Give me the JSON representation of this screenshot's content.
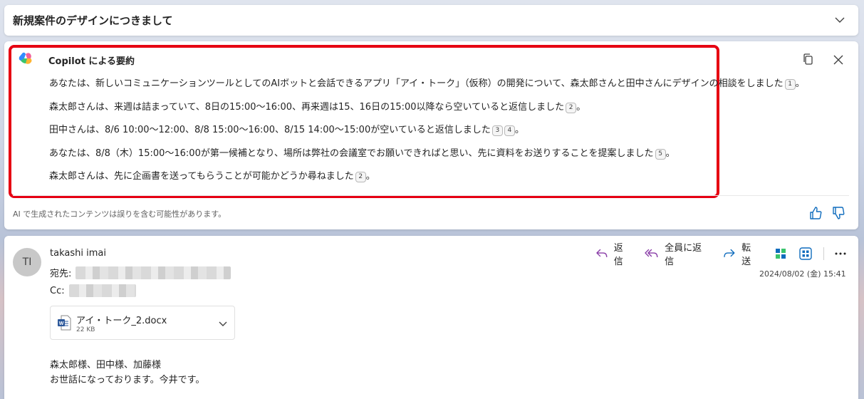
{
  "subject": "新規案件のデザインにつきまして",
  "copilot": {
    "title": "Copilot による要約",
    "summary": [
      {
        "text": "あなたは、新しいコミュニケーションツールとしてのAIボットと会話できるアプリ「アイ・トーク」（仮称）の開発について、森太郎さんと田中さんにデザインの相談をしました",
        "cites": [
          "1"
        ],
        "end": "。"
      },
      {
        "text": "森太郎さんは、来週は詰まっていて、8日の15:00〜16:00、再来週は15、16日の15:00以降なら空いていると返信しました",
        "cites": [
          "2"
        ],
        "end": "。"
      },
      {
        "text": "田中さんは、8/6 10:00〜12:00、8/8 15:00〜16:00、8/15 14:00〜15:00が空いていると返信しました",
        "cites": [
          "3",
          "4"
        ],
        "end": "。"
      },
      {
        "text": "あなたは、8/8（木）15:00〜16:00が第一候補となり、場所は弊社の会議室でお願いできればと思い、先に資料をお送りすることを提案しました",
        "cites": [
          "5"
        ],
        "end": "。"
      },
      {
        "text": "森太郎さんは、先に企画書を送ってもらうことが可能かどうか尋ねました",
        "cites": [
          "2"
        ],
        "end": "。"
      }
    ],
    "disclaimer": "AI で生成されたコンテンツは誤りを含む可能性があります。"
  },
  "mail": {
    "avatar_initials": "TI",
    "sender": "takashi imai",
    "to_label": "宛先:",
    "cc_label": "Cc:",
    "actions": {
      "reply": "返信",
      "reply_all": "全員に返信",
      "forward": "転送"
    },
    "date": "2024/08/02 (金) 15:41",
    "attachment": {
      "name": "アイ・トーク_2.docx",
      "size": "22 KB"
    },
    "body": [
      "森太郎様、田中様、加藤様",
      "お世話になっております。今井です。"
    ]
  },
  "colors": {
    "highlight_frame": "#e60012",
    "accent": "#0f6cbd",
    "reply_icon": "#8a3fa8"
  }
}
